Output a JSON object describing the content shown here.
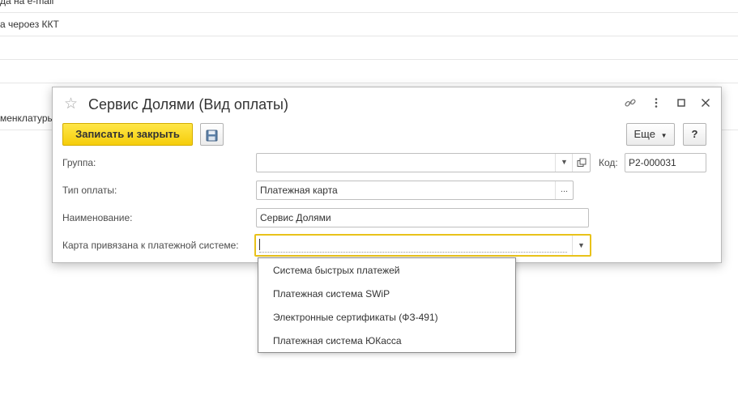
{
  "background_list": {
    "rows": [
      "да на e-mail",
      "а чероез ККТ",
      "",
      "",
      "менклатуры"
    ]
  },
  "dialog": {
    "title": "Сервис Долями (Вид оплаты)",
    "toolbar": {
      "save_close_label": "Записать и закрыть",
      "more_label": "Еще",
      "help_label": "?"
    },
    "fields": {
      "group_label": "Группа:",
      "group_value": "",
      "code_label": "Код:",
      "code_value": "Р2-000031",
      "payment_type_label": "Тип оплаты:",
      "payment_type_value": "Платежная карта",
      "name_label": "Наименование:",
      "name_value": "Сервис Долями",
      "card_system_label": "Карта привязана к платежной системе:",
      "card_system_value": ""
    }
  },
  "dropdown": {
    "options": [
      "Система быстрых платежей",
      "Платежная система SWiP",
      "Электронные сертификаты (ФЗ-491)",
      "Платежная система ЮКасса"
    ]
  },
  "colors": {
    "accent": "#f5cd0a",
    "focus_border": "#e8c21a"
  }
}
